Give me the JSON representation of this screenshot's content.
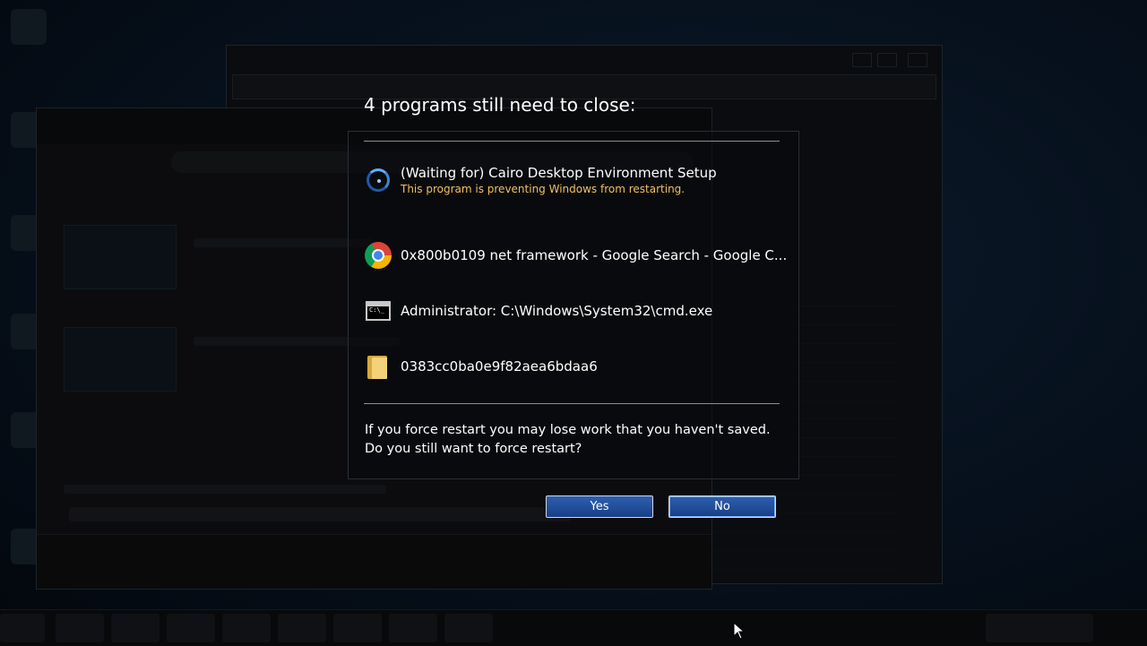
{
  "dialog": {
    "heading": "4 programs still need to close:",
    "programs": [
      {
        "name": "(Waiting for) Cairo Desktop Environment Setup",
        "note": "This program is preventing Windows from restarting.",
        "icon": "spinner-icon"
      },
      {
        "name": "0x800b0109 net framework - Google Search - Google C...",
        "icon": "chrome-icon"
      },
      {
        "name": "Administrator: C:\\Windows\\System32\\cmd.exe",
        "icon": "cmd-icon"
      },
      {
        "name": "0383cc0ba0e9f82aea6bdaa6",
        "icon": "folder-icon"
      }
    ],
    "warning_line1": "If you force restart you may lose work that you haven't saved.",
    "warning_line2": "Do you still want to force restart?",
    "yes_label": "Yes",
    "no_label": "No"
  },
  "colors": {
    "note": "#f0c060",
    "button": "#1f4a96"
  }
}
